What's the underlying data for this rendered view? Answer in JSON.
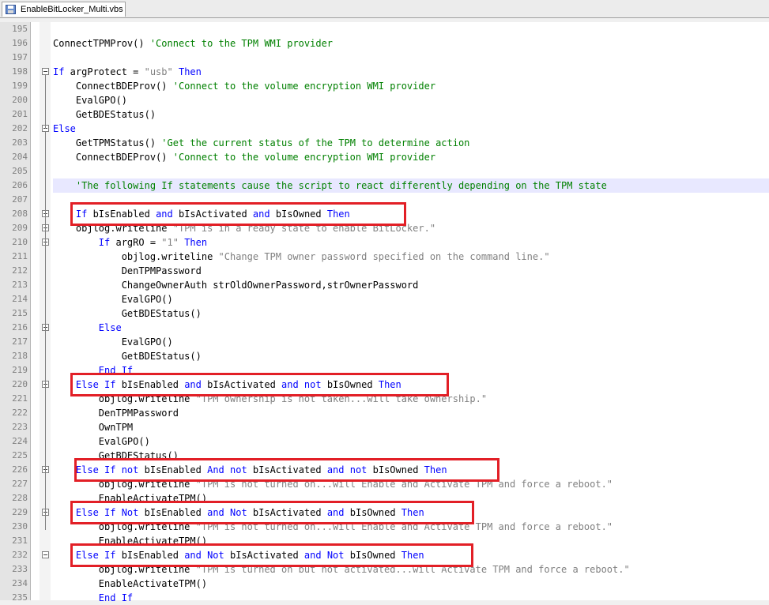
{
  "tab": {
    "filename": "EnableBitLocker_Multi.vbs",
    "icon": "vbs-file-icon"
  },
  "colors": {
    "keyword": "#0000ff",
    "string": "#808080",
    "comment": "#008000",
    "highlight_box": "#e21f26",
    "current_line": "#e8e8ff"
  },
  "lines": [
    {
      "num": "195",
      "segs": []
    },
    {
      "num": "196",
      "segs": [
        [
          "p",
          "ConnectTPMProv() "
        ],
        [
          "c",
          "'Connect to the TPM WMI provider"
        ]
      ]
    },
    {
      "num": "197",
      "segs": []
    },
    {
      "num": "198",
      "segs": [
        [
          "k",
          "If"
        ],
        [
          "p",
          " argProtect = "
        ],
        [
          "s",
          "\"usb\""
        ],
        [
          "p",
          " "
        ],
        [
          "k",
          "Then"
        ]
      ]
    },
    {
      "num": "199",
      "segs": [
        [
          "p",
          "    ConnectBDEProv() "
        ],
        [
          "c",
          "'Connect to the volume encryption WMI provider"
        ]
      ]
    },
    {
      "num": "200",
      "segs": [
        [
          "p",
          "    EvalGPO()"
        ]
      ]
    },
    {
      "num": "201",
      "segs": [
        [
          "p",
          "    GetBDEStatus()"
        ]
      ]
    },
    {
      "num": "202",
      "segs": [
        [
          "k",
          "Else"
        ]
      ]
    },
    {
      "num": "203",
      "segs": [
        [
          "p",
          "    GetTPMStatus() "
        ],
        [
          "c",
          "'Get the current status of the TPM to determine action"
        ]
      ]
    },
    {
      "num": "204",
      "segs": [
        [
          "p",
          "    ConnectBDEProv() "
        ],
        [
          "c",
          "'Connect to the volume encryption WMI provider"
        ]
      ]
    },
    {
      "num": "205",
      "segs": []
    },
    {
      "num": "206",
      "segs": [
        [
          "c",
          "    'The following If statements cause the script to react differently depending on the TPM state"
        ]
      ]
    },
    {
      "num": "207",
      "segs": []
    },
    {
      "num": "208",
      "segs": [
        [
          "p",
          "    "
        ],
        [
          "k",
          "If"
        ],
        [
          "p",
          " bIsEnabled "
        ],
        [
          "k",
          "and"
        ],
        [
          "p",
          " bIsActivated "
        ],
        [
          "k",
          "and"
        ],
        [
          "p",
          " bIsOwned "
        ],
        [
          "k",
          "Then"
        ]
      ]
    },
    {
      "num": "209",
      "segs": [
        [
          "p",
          "    objlog.writeline "
        ],
        [
          "s",
          "\"TPM is in a ready state to enable BitLocker.\""
        ]
      ]
    },
    {
      "num": "210",
      "segs": [
        [
          "p",
          "        "
        ],
        [
          "k",
          "If"
        ],
        [
          "p",
          " argRO = "
        ],
        [
          "s",
          "\"1\""
        ],
        [
          "p",
          " "
        ],
        [
          "k",
          "Then"
        ]
      ]
    },
    {
      "num": "211",
      "segs": [
        [
          "p",
          "            objlog.writeline "
        ],
        [
          "s",
          "\"Change TPM owner password specified on the command line.\""
        ]
      ]
    },
    {
      "num": "212",
      "segs": [
        [
          "p",
          "            DenTPMPassword"
        ]
      ]
    },
    {
      "num": "213",
      "segs": [
        [
          "p",
          "            ChangeOwnerAuth strOldOwnerPassword,strOwnerPassword"
        ]
      ]
    },
    {
      "num": "214",
      "segs": [
        [
          "p",
          "            EvalGPO()"
        ]
      ]
    },
    {
      "num": "215",
      "segs": [
        [
          "p",
          "            GetBDEStatus()"
        ]
      ]
    },
    {
      "num": "216",
      "segs": [
        [
          "p",
          "        "
        ],
        [
          "k",
          "Else"
        ]
      ]
    },
    {
      "num": "217",
      "segs": [
        [
          "p",
          "            EvalGPO()"
        ]
      ]
    },
    {
      "num": "218",
      "segs": [
        [
          "p",
          "            GetBDEStatus()"
        ]
      ]
    },
    {
      "num": "219",
      "segs": [
        [
          "p",
          "        "
        ],
        [
          "k",
          "End If"
        ]
      ]
    },
    {
      "num": "220",
      "segs": [
        [
          "p",
          "    "
        ],
        [
          "k",
          "Else If"
        ],
        [
          "p",
          " bIsEnabled "
        ],
        [
          "k",
          "and"
        ],
        [
          "p",
          " bIsActivated "
        ],
        [
          "k",
          "and not"
        ],
        [
          "p",
          " bIsOwned "
        ],
        [
          "k",
          "Then"
        ]
      ]
    },
    {
      "num": "221",
      "segs": [
        [
          "p",
          "        objlog.writeline "
        ],
        [
          "s",
          "\"TPM ownership is not taken...will take ownership.\""
        ]
      ]
    },
    {
      "num": "222",
      "segs": [
        [
          "p",
          "        DenTPMPassword"
        ]
      ]
    },
    {
      "num": "223",
      "segs": [
        [
          "p",
          "        OwnTPM"
        ]
      ]
    },
    {
      "num": "224",
      "segs": [
        [
          "p",
          "        EvalGPO()"
        ]
      ]
    },
    {
      "num": "225",
      "segs": [
        [
          "p",
          "        GetBDEStatus()"
        ]
      ]
    },
    {
      "num": "226",
      "segs": [
        [
          "p",
          "    "
        ],
        [
          "k",
          "Else If not"
        ],
        [
          "p",
          " bIsEnabled "
        ],
        [
          "k",
          "And not"
        ],
        [
          "p",
          " bIsActivated "
        ],
        [
          "k",
          "and not"
        ],
        [
          "p",
          " bIsOwned "
        ],
        [
          "k",
          "Then"
        ]
      ]
    },
    {
      "num": "227",
      "segs": [
        [
          "p",
          "        objlog.writeline "
        ],
        [
          "s",
          "\"TPM is not turned on...will Enable and Activate TPM and force a reboot.\""
        ]
      ]
    },
    {
      "num": "228",
      "segs": [
        [
          "p",
          "        EnableActivateTPM()"
        ]
      ]
    },
    {
      "num": "229",
      "segs": [
        [
          "p",
          "    "
        ],
        [
          "k",
          "Else If Not"
        ],
        [
          "p",
          " bIsEnabled "
        ],
        [
          "k",
          "and Not"
        ],
        [
          "p",
          " bIsActivated "
        ],
        [
          "k",
          "and"
        ],
        [
          "p",
          " bIsOwned "
        ],
        [
          "k",
          "Then"
        ]
      ]
    },
    {
      "num": "230",
      "segs": [
        [
          "p",
          "        objlog.writeline "
        ],
        [
          "s",
          "\"TPM is not turned on...will Enable and Activate TPM and force a reboot.\""
        ]
      ]
    },
    {
      "num": "231",
      "segs": [
        [
          "p",
          "        EnableActivateTPM()"
        ]
      ]
    },
    {
      "num": "232",
      "segs": [
        [
          "p",
          "    "
        ],
        [
          "k",
          "Else If"
        ],
        [
          "p",
          " bIsEnabled "
        ],
        [
          "k",
          "and Not"
        ],
        [
          "p",
          " bIsActivated "
        ],
        [
          "k",
          "and Not"
        ],
        [
          "p",
          " bIsOwned "
        ],
        [
          "k",
          "Then"
        ]
      ]
    },
    {
      "num": "233",
      "segs": [
        [
          "p",
          "        objlog.writeline "
        ],
        [
          "s",
          "\"TPM is turned on but not activated...will Activate TPM and force a reboot.\""
        ]
      ]
    },
    {
      "num": "234",
      "segs": [
        [
          "p",
          "        EnableActivateTPM()"
        ]
      ]
    },
    {
      "num": "235",
      "segs": [
        [
          "p",
          "        "
        ],
        [
          "k",
          "End If"
        ]
      ]
    }
  ]
}
